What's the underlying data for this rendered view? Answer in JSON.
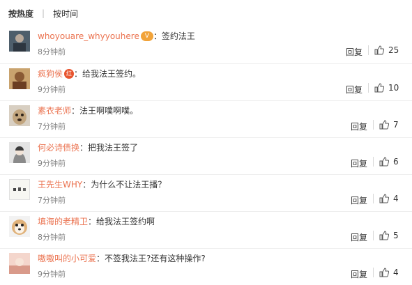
{
  "sort": {
    "hot_label": "按热度",
    "time_label": "按时间"
  },
  "comments": [
    {
      "user": "whoyouare_whyyouhere",
      "badge": "vip",
      "text": "：签约法王",
      "time": "8分钟前",
      "reply": "回复",
      "likes": "25"
    },
    {
      "user": "疯狗侯",
      "badge": "red",
      "text": "：给我法王签约。",
      "time": "9分钟前",
      "reply": "回复",
      "likes": "10"
    },
    {
      "user": "素衣老师",
      "badge": "",
      "text": "：法王啊噗啊噗。",
      "time": "7分钟前",
      "reply": "回复",
      "likes": "7"
    },
    {
      "user": "何必诗债换",
      "badge": "",
      "text": "：把我法王签了",
      "time": "9分钟前",
      "reply": "回复",
      "likes": "6"
    },
    {
      "user": "王先生WHY",
      "badge": "",
      "text": "：为什么不让法王播？",
      "time": "7分钟前",
      "reply": "回复",
      "likes": "4"
    },
    {
      "user": "填海的老精卫",
      "badge": "",
      "text": "：给我法王签约啊",
      "time": "8分钟前",
      "reply": "回复",
      "likes": "5"
    },
    {
      "user": "嗷嗷叫的小可爱",
      "badge": "",
      "text": "：不签我法王?还有这种操作?",
      "time": "9分钟前",
      "reply": "回复",
      "likes": "4"
    }
  ],
  "colors": {
    "username": "#eb7350",
    "time": "#808080"
  }
}
